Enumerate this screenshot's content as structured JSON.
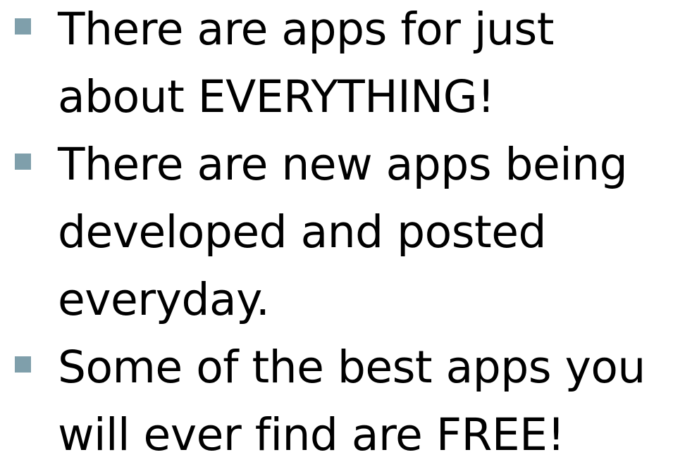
{
  "slide": {
    "bullet_color": "#7f9fab",
    "bullets": [
      {
        "lines": [
          "There are apps for just",
          "about EVERYTHING!"
        ]
      },
      {
        "lines": [
          "There are new apps being",
          "developed and posted",
          "everyday."
        ]
      },
      {
        "lines": [
          "Some of the best apps you",
          "will ever find are FREE!"
        ]
      }
    ]
  }
}
